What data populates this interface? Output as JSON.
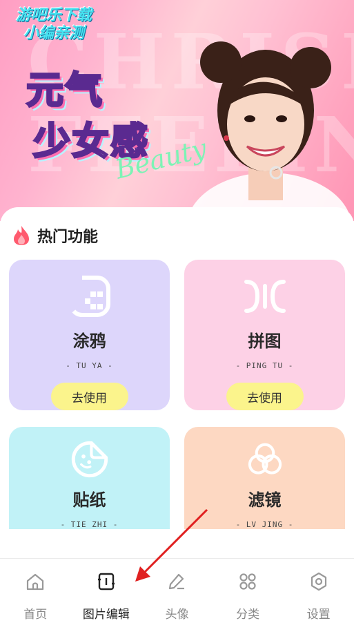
{
  "banner": {
    "watermark_line1": "游吧乐下载",
    "watermark_line2": "小编亲测",
    "title_line1": "元气",
    "title_line2": "少女感",
    "script_text": "Beauty",
    "bg_text": "CHRISH FEELING"
  },
  "hot": {
    "title": "热门功能",
    "icon": "fire-icon"
  },
  "cards": [
    {
      "name": "涂鸦",
      "pinyin": "- TU YA -",
      "button": "去使用",
      "color": "#ddd6fb",
      "icon": "doodle-icon"
    },
    {
      "name": "拼图",
      "pinyin": "- PING TU -",
      "button": "去使用",
      "color": "#fdd1e6",
      "icon": "collage-icon"
    },
    {
      "name": "贴纸",
      "pinyin": "- TIE ZHI -",
      "color": "#c1f2f7",
      "icon": "sticker-icon"
    },
    {
      "name": "滤镜",
      "pinyin": "- LV JING -",
      "color": "#fdd8c2",
      "icon": "filter-icon"
    }
  ],
  "nav": [
    {
      "label": "首页",
      "icon": "home-icon",
      "active": false
    },
    {
      "label": "图片编辑",
      "icon": "photo-edit-icon",
      "active": true
    },
    {
      "label": "头像",
      "icon": "pen-icon",
      "active": false
    },
    {
      "label": "分类",
      "icon": "grid-icon",
      "active": false
    },
    {
      "label": "设置",
      "icon": "settings-icon",
      "active": false
    }
  ],
  "colors": {
    "accent_yellow": "#fbf48c",
    "arrow_red": "#e02020",
    "fire": "#ff5a6e"
  }
}
